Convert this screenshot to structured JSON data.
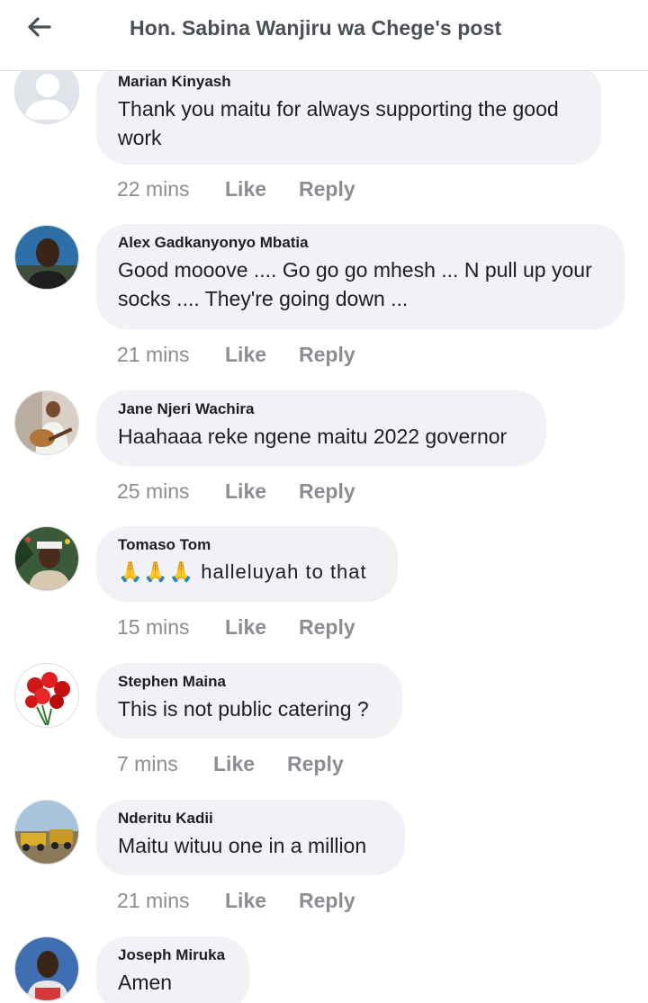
{
  "header": {
    "title": "Hon. Sabina Wanjiru wa Chege's post",
    "back_icon": "back-arrow-icon"
  },
  "comments": [
    {
      "author": "Marian Kinyash",
      "text": "Thank you maitu for always supporting the good work",
      "time": "22 mins",
      "like": "Like",
      "reply": "Reply",
      "avatar": "default-avatar"
    },
    {
      "author": "Alex Gadkanyonyo Mbatia",
      "text": "Good mooove .... Go go go mhesh ... N pull up your socks .... They're going down ...",
      "time": "21 mins",
      "like": "Like",
      "reply": "Reply",
      "avatar": "profile-photo"
    },
    {
      "author": "Jane Njeri Wachira",
      "text": "Haahaaa reke ngene maitu 2022 governor",
      "time": "25 mins",
      "like": "Like",
      "reply": "Reply",
      "avatar": "profile-photo"
    },
    {
      "author": "Tomaso Tom",
      "text": "🙏🙏🙏 halleluyah to that",
      "time": "15 mins",
      "like": "Like",
      "reply": "Reply",
      "avatar": "profile-photo"
    },
    {
      "author": "Stephen Maina",
      "text": "This is not public catering ?",
      "time": "7 mins",
      "like": "Like",
      "reply": "Reply",
      "avatar": "roses-photo"
    },
    {
      "author": "Nderitu Kadii",
      "text": "Maitu wituu one in a million",
      "time": "21 mins",
      "like": "Like",
      "reply": "Reply",
      "avatar": "trucks-photo"
    },
    {
      "author": "Joseph Miruka",
      "text": "Amen",
      "avatar": "profile-photo"
    }
  ],
  "colors": {
    "bubble": "#f0f2f5",
    "meta": "#8a8d91",
    "title": "#4b4f56"
  }
}
